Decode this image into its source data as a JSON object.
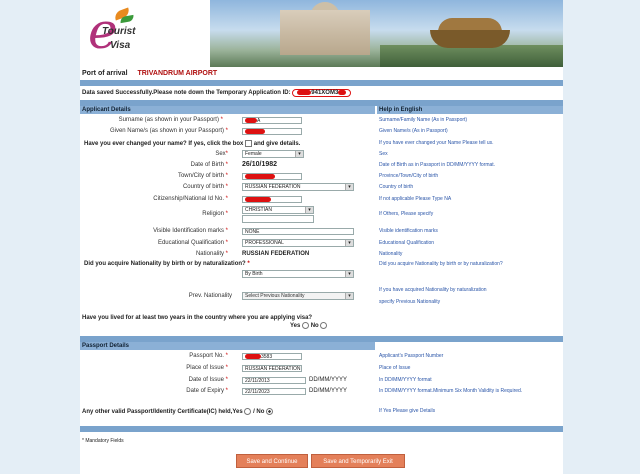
{
  "header": {
    "logo_e": "e",
    "logo_tourist": "Tourist",
    "logo_visa": "Visa"
  },
  "arrival": {
    "label": "Port of arrival",
    "value": "TRIVANDRUM AIRPORT"
  },
  "notice": {
    "text": "Data saved Successfully.Please note down the Temporary Application ID:",
    "id_partial": "941XOM3"
  },
  "sections": {
    "applicant": "Applicant Details",
    "help": "Help in English",
    "passport": "Passport Details"
  },
  "applicant": {
    "surname_label": "Surname (as shown in your Passport)",
    "surname_value": "A",
    "given_label": "Given Name/s (as shown in your Passport)",
    "changed_q": "Have you ever changed your name? If yes, click the box",
    "changed_q2": "and give details.",
    "sex_label": "Sex",
    "sex_value": "Female",
    "dob_label": "Date of Birth",
    "dob_value": "26/10/1982",
    "town_label": "Town/City of birth",
    "country_label": "Country of birth",
    "country_value": "RUSSIAN FEDERATION",
    "citizen_label": "Citizenship/National Id No.",
    "religion_label": "Religion",
    "religion_value": "CHRISTIAN",
    "marks_label": "Visible Identification marks",
    "marks_value": "NONE",
    "edu_label": "Educational Qualification",
    "edu_value": "PROFESSIONAL",
    "nat_label": "Nationality",
    "nat_value": "RUSSIAN FEDERATION",
    "acquire_q": "Did you acquire Nationality by birth or by naturalization?",
    "acquire_value": "By Birth",
    "prev_nat_label": "Prev. Nationality",
    "prev_nat_value": "Select Previous Nationality",
    "lived_q": "Have you lived for at least two years in the country where you are applying visa?",
    "yes": "Yes",
    "no": "No"
  },
  "help": {
    "surname": "Surname/Family Name (As in Passport)",
    "given": "Given Name/s (As in Passport)",
    "changed": "If you have ever changed your Name Please tell us.",
    "sex": "Sex",
    "dob": "Date of Birth as in Passport in DD/MM/YYYY format.",
    "town": "Province/Town/City of birth",
    "country": "Country of birth",
    "citizen": "If not applicable Please Type NA",
    "religion": "If Others, Please specify",
    "marks": "Visible identification marks",
    "edu": "Educational Qualification",
    "nat": "Nationality",
    "acquire": "Did you acquire Nationality by birth or by naturalization?",
    "natur1": "If you have acquired Nationality by naturalization",
    "natur2": "specify Previous Nationality",
    "passport_no": "Applicant's Passport Number",
    "place": "Place of Issue",
    "doi": "In DD/MM/YYYY format",
    "doe": "In DD/MM/YYYY format.Minimum Six Month Validity is Required.",
    "other": "If Yes Please give Details"
  },
  "passport": {
    "no_label": "Passport No.",
    "no_value": "3583",
    "place_label": "Place of Issue",
    "place_value": "RUSSIAN FEDERATION",
    "doi_label": "Date of Issue",
    "doi_value": "22/11/2013",
    "doe_label": "Date of Expiry",
    "doe_value": "22/11/2023",
    "fmt": "DD/MM/YYYY",
    "other_q": "Any other valid Passport/Identity Certificate(IC) held,Yes",
    "slash": "/",
    "no": "No"
  },
  "footer": {
    "mandatory": "* Mandatory Fields",
    "save_continue": "Save and Continue",
    "save_exit": "Save and Temporarily Exit"
  }
}
